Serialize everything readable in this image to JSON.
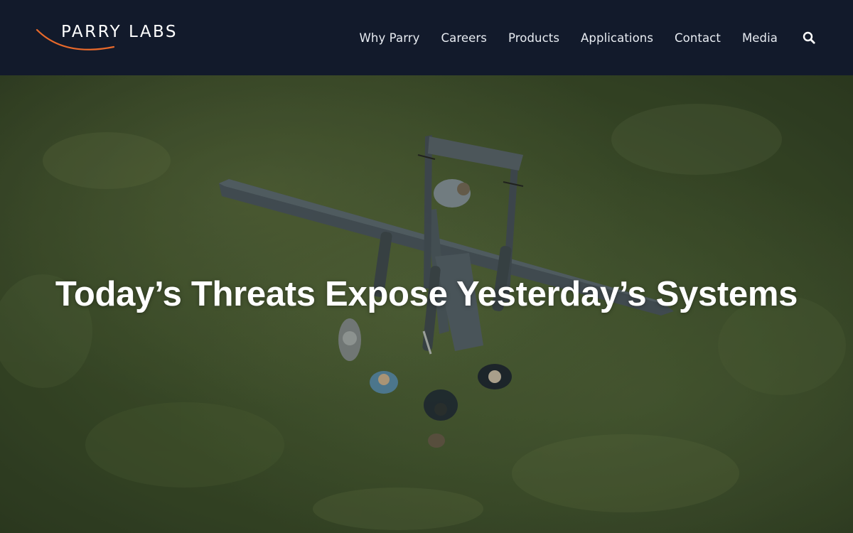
{
  "brand": {
    "name": "PARRY LABS",
    "accent_color": "#e8692b",
    "header_bg": "#121a2b"
  },
  "nav": {
    "items": [
      {
        "label": "Why Parry"
      },
      {
        "label": "Careers"
      },
      {
        "label": "Products"
      },
      {
        "label": "Applications"
      },
      {
        "label": "Contact"
      },
      {
        "label": "Media"
      }
    ],
    "search_icon": "search-icon"
  },
  "hero": {
    "title": "Today’s Threats Expose Yesterday’s Systems",
    "background_description_icon": "aerial-drone-photo"
  }
}
